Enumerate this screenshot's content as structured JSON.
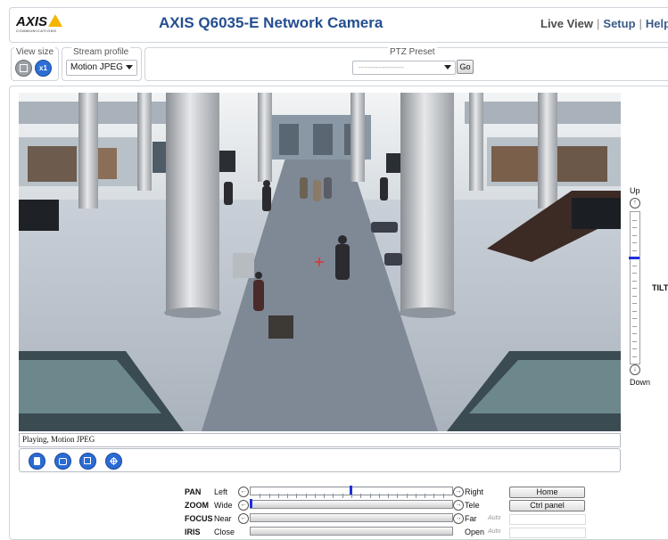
{
  "header": {
    "logo_text": "AXIS",
    "logo_subtext": "COMMUNICATIONS",
    "title": "AXIS Q6035-E Network Camera",
    "nav": [
      "Live View",
      "Setup",
      "Help"
    ],
    "nav_separator": "|"
  },
  "toolbar": {
    "view_size": {
      "legend": "View size",
      "buttons": [
        {
          "name": "fit",
          "icon": "fit-window-icon"
        },
        {
          "name": "x1",
          "label": "x1"
        }
      ]
    },
    "stream_profile": {
      "legend": "Stream profile",
      "value": "Motion JPEG"
    },
    "ptz_preset": {
      "legend": "PTZ Preset",
      "value": "-------------------",
      "go_label": "Go"
    }
  },
  "video": {
    "description_icon": "camera-live-view",
    "status_text": "Playing, Motion JPEG",
    "controls": [
      "stop-icon",
      "snapshot-icon",
      "fullscreen-icon",
      "ptz-click-icon"
    ]
  },
  "tilt": {
    "label": "TILT",
    "up_label": "Up",
    "down_label": "Down",
    "position": 0.3
  },
  "ptz": {
    "rows": [
      {
        "label": "PAN",
        "left": "Left",
        "right": "Right",
        "position": 0.5,
        "button": "Home"
      },
      {
        "label": "ZOOM",
        "left": "Wide",
        "right": "Tele",
        "position": 0.0,
        "button": "Ctrl panel"
      },
      {
        "label": "FOCUS",
        "left": "Near",
        "right": "Far",
        "auto": "Auto"
      },
      {
        "label": "IRIS",
        "left": "Close",
        "right": "Open",
        "auto": "Auto"
      }
    ]
  },
  "colors": {
    "title_blue": "#244e8f",
    "button_blue": "#2a6bd4",
    "slider_thumb": "#1f2fe0",
    "border_gray": "#cfd4dc"
  }
}
